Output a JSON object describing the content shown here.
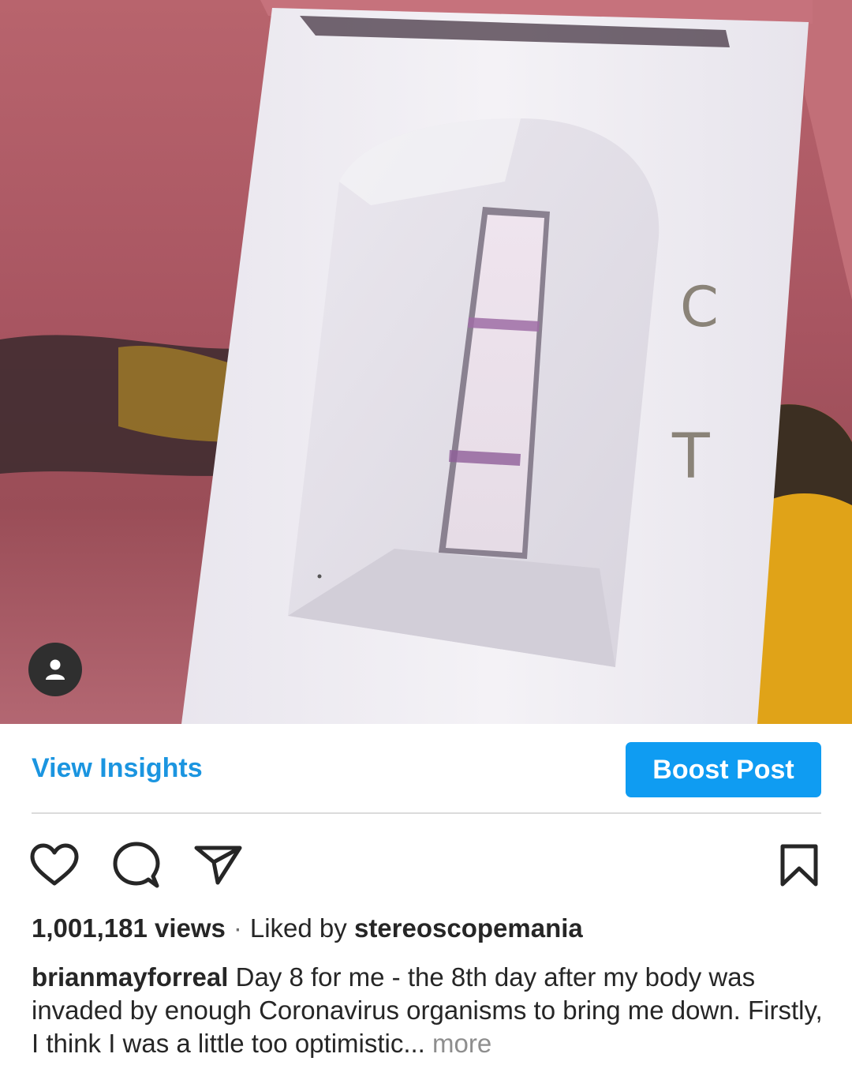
{
  "media": {
    "test_letters": {
      "control": "C",
      "test": "T"
    },
    "user_tag_icon": "person-icon"
  },
  "post_actions": {
    "view_insights": "View Insights",
    "boost_post": "Boost Post",
    "accent_color": "#0f9cf2"
  },
  "icons": {
    "like": "heart-icon",
    "comment": "comment-icon",
    "share": "paper-plane-icon",
    "save": "bookmark-icon"
  },
  "stats": {
    "views": "1,001,181 views",
    "separator": "·",
    "liked_by_prefix": "Liked by",
    "liked_by_user": "stereoscopemania"
  },
  "caption": {
    "username": "brianmayforreal",
    "text": "Day 8 for me - the 8th day after my body was invaded by enough Coronavirus organisms to bring me down.  Firstly, I think I was a little too optimistic...",
    "more": "more"
  }
}
